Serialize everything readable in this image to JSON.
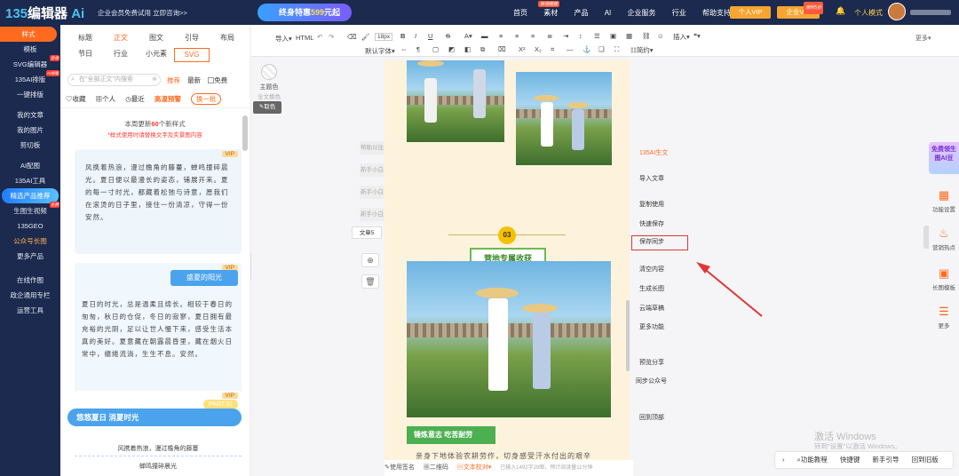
{
  "topbar": {
    "logo_num": "135",
    "logo_text": "编辑器",
    "logo_suffix": "Ai",
    "promo": "企业会员免费试用 立即咨询>>",
    "banner_prefix": "终身特惠",
    "banner_price": "599",
    "banner_suffix": "元起",
    "nav": [
      {
        "label": "首页"
      },
      {
        "label": "素材",
        "tag": "新增模板"
      },
      {
        "label": "产品"
      },
      {
        "label": "AI"
      },
      {
        "label": "企业服务"
      },
      {
        "label": "行业"
      },
      {
        "label": "帮助支持"
      }
    ],
    "vip_personal": "个人VIP",
    "vip_enterprise": "企业VIP",
    "vip_enterprise_tag": "限时5折",
    "mode": "个人模式",
    "bell_icon": "bell-icon"
  },
  "leftnav": {
    "items": [
      {
        "label": "样式",
        "active": true
      },
      {
        "label": "模板"
      },
      {
        "label": "SVG编辑器",
        "badge": "新增"
      },
      {
        "label": "135AI排版",
        "badge": "AI排版"
      },
      {
        "label": "一键排版"
      },
      {
        "label": "我的文章"
      },
      {
        "label": "我的图片"
      },
      {
        "label": "剪切板"
      },
      {
        "label": "AI配图"
      },
      {
        "label": "135AI工具"
      },
      {
        "label": "精选产品推荐"
      },
      {
        "label": "生图生视频",
        "badge": "免费"
      },
      {
        "label": "135GEO"
      },
      {
        "label": "公众号长图"
      },
      {
        "label": "更多产品"
      },
      {
        "label": "在线作图"
      },
      {
        "label": "政企通用专栏"
      },
      {
        "label": "运营工具"
      }
    ]
  },
  "panel": {
    "tabs_row1": [
      "标题",
      "正文",
      "图文",
      "引导",
      "布局"
    ],
    "tabs_row2": [
      "节日",
      "行业",
      "小元素",
      "SVG"
    ],
    "search_placeholder": "在\"全部正文\"内搜索",
    "filter_recommend": "推荐",
    "filter_latest": "最新",
    "filter_free": "免费",
    "sub_collect": "收藏",
    "sub_personal": "个人",
    "sub_recent": "最近",
    "sub_hot": "高温预警",
    "sub_batch": "换一批",
    "update_prefix": "本周更新",
    "update_count": "60",
    "update_suffix": "个新样式",
    "update_note": "*样式使用时请替换文字及实景图内容",
    "vip_label": "VIP",
    "card1_text": "风携着热浪，漫过檐角的藤蔓，蝉鸣撞碎晨光。夏日便以最漫长的姿态，铺展开来。夏的每一寸时光，都藏着松弛与诗意，愿我们在滚烫的日子里，接住一份清凉，守得一份安然。",
    "card2_title": "盛夏的阳光",
    "card2_text": "夏日的时光，总是温柔且绵长。相较于春日的匆匆，秋日的仓促，冬日的寂寥，夏日拥有最充裕的光阴，足以让世人慢下来，感受生活本真的美好。夏意藏在朝露晨昏里，藏在烟火日常中，缱绻流淌，生生不息。安然。",
    "card3_title": "悠悠夏日 消夏时光",
    "card3_part": "PART.01",
    "card3_line1": "风携着热浪，漫过檐角的藤蔓",
    "card3_line2": "蝉鸣撞碎晨光"
  },
  "toolbar": {
    "import": "导入",
    "html": "HTML",
    "font_size": "18px",
    "default_font": "默认字体",
    "insert": "插入",
    "simplified": "简约",
    "more": "更多"
  },
  "editor_side": {
    "theme_color": "主题色",
    "full_color": "全文换色",
    "pick_color": "取色",
    "ghosts": [
      "帮助以往",
      "新手小白",
      "新手小白",
      "新手小白"
    ],
    "article": "文章5"
  },
  "article": {
    "step_num": "03",
    "step_title": "营地专属收获",
    "green_tag": "锤炼意志 吃苦耐劳",
    "body": "亲身下地体验农耕劳作，切身感受汗水付出的艰辛"
  },
  "actions": {
    "ai": "135AI生文",
    "items": [
      "导入文章",
      "复制使用",
      "快速保存",
      "保存同步",
      "清空内容",
      "生成长图",
      "云端草稿",
      "更多功能",
      "预览分享",
      "同步公众号",
      "回到顶部"
    ]
  },
  "rightrail": {
    "ai_tag": "免费领生图AI豆",
    "items": [
      {
        "label": "功能设置",
        "icon": "grid-icon"
      },
      {
        "label": "营销热点",
        "icon": "flame-icon"
      },
      {
        "label": "长图模板",
        "icon": "image-icon"
      },
      {
        "label": "更多",
        "icon": "menu-icon"
      }
    ]
  },
  "bottombar": {
    "signature": "使用签名",
    "qrcode": "二维码",
    "proofread": "文本校对",
    "count": "已输入1492字29图，预计阅读量11分钟"
  },
  "help": {
    "items": [
      "功能教程",
      "快捷键",
      "新手引导",
      "回到旧版"
    ]
  },
  "watermark": {
    "line1": "激活 Windows",
    "line2": "转到\"设置\"以激活 Windows。"
  }
}
